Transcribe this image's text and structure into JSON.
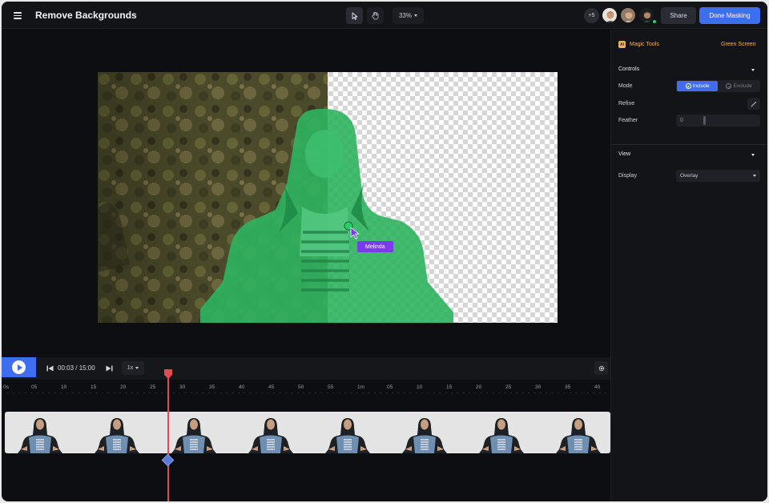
{
  "header": {
    "title": "Remove Backgrounds",
    "zoom": "33%",
    "extra_collaborators": "+5",
    "share_label": "Share",
    "done_label": "Done Masking"
  },
  "canvas": {
    "cursor_label": "Melinda",
    "mask_color": "#2ccc6a",
    "cursor_color": "#7b3bea"
  },
  "panel": {
    "tool_name": "Magic Tools",
    "tool_icon_text": "AI",
    "preset": "Green Screen",
    "controls_title": "Controls",
    "mode_label": "Mode",
    "mode_include": "Include",
    "mode_exclude": "Exclude",
    "mode_selected": "Include",
    "refine_label": "Refine",
    "feather_label": "Feather",
    "feather_value": "0",
    "view_title": "View",
    "display_label": "Display",
    "display_value": "Overlay"
  },
  "timeline": {
    "time": "00:03 / 15:00",
    "speed": "1x",
    "ticks": [
      "0s",
      "05",
      "10",
      "15",
      "20",
      "25",
      "30",
      "35",
      "40",
      "45",
      "50",
      "55",
      "1m",
      "05",
      "10",
      "15",
      "20",
      "25",
      "30",
      "35",
      "40"
    ]
  },
  "colors": {
    "accent": "#3e6df0",
    "preset": "#f0b35a",
    "playhead": "#e5484d"
  }
}
